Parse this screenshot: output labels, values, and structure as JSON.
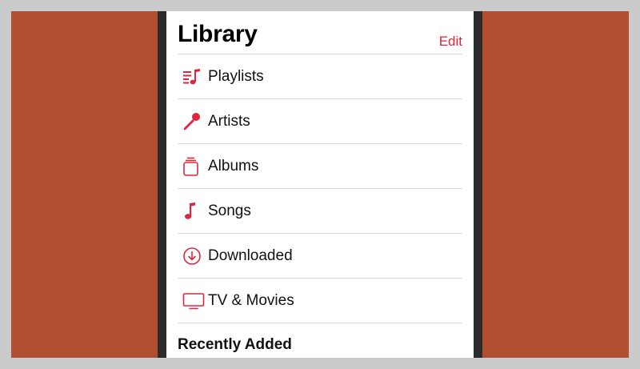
{
  "library": {
    "title": "Library",
    "edit_label": "Edit",
    "accent_color": "#e0263c",
    "items": [
      {
        "label": "Playlists",
        "icon": "playlist-icon"
      },
      {
        "label": "Artists",
        "icon": "microphone-icon"
      },
      {
        "label": "Albums",
        "icon": "album-stack-icon"
      },
      {
        "label": "Songs",
        "icon": "music-note-icon"
      },
      {
        "label": "Downloaded",
        "icon": "download-circle-icon"
      },
      {
        "label": "TV & Movies",
        "icon": "tv-icon"
      }
    ],
    "recently_added_heading": "Recently Added"
  }
}
